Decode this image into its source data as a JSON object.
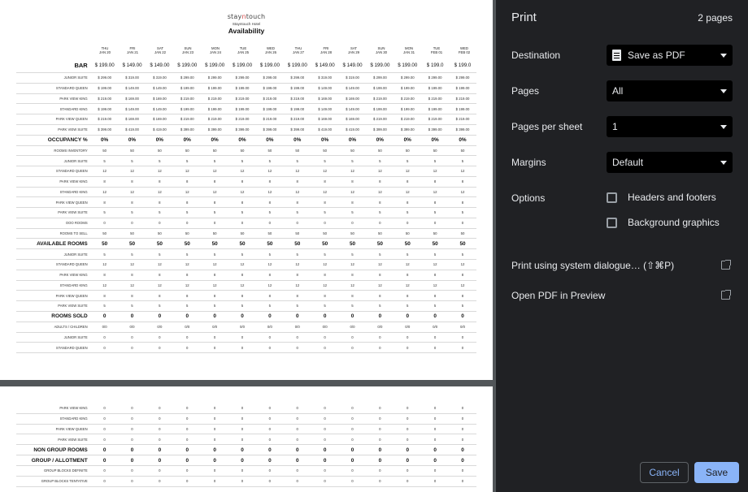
{
  "report": {
    "logo_prefix": "stay",
    "logo_accent": "n",
    "logo_suffix": "touch",
    "hotel": "Stayntouch Hotel",
    "title": "Availability",
    "dates": [
      {
        "d": "THU",
        "m": "JAN 20"
      },
      {
        "d": "FRI",
        "m": "JAN 21"
      },
      {
        "d": "SAT",
        "m": "JAN 22"
      },
      {
        "d": "SUN",
        "m": "JAN 23"
      },
      {
        "d": "MON",
        "m": "JAN 24"
      },
      {
        "d": "TUE",
        "m": "JAN 25"
      },
      {
        "d": "WED",
        "m": "JAN 26"
      },
      {
        "d": "THU",
        "m": "JAN 27"
      },
      {
        "d": "FRI",
        "m": "JAN 28"
      },
      {
        "d": "SAT",
        "m": "JAN 29"
      },
      {
        "d": "SUN",
        "m": "JAN 30"
      },
      {
        "d": "MON",
        "m": "JAN 31"
      },
      {
        "d": "TUE",
        "m": "FEB 01"
      },
      {
        "d": "WED",
        "m": "FEB 02"
      }
    ],
    "page1_rows": [
      {
        "label": "BAR",
        "style": "bar",
        "values": [
          "$ 199.00",
          "$ 149.00",
          "$ 149.00",
          "$ 199.00",
          "$ 199.00",
          "$ 199.00",
          "$ 199.00",
          "$ 199.00",
          "$ 149.00",
          "$ 149.00",
          "$ 199.00",
          "$ 199.00",
          "$ 199.0",
          "$ 199.0"
        ]
      },
      {
        "label": "JUNIOR SUITE",
        "values": [
          "$ 299.00",
          "$ 319.00",
          "$ 319.00",
          "$ 299.00",
          "$ 299.00",
          "$ 299.00",
          "$ 299.00",
          "$ 299.00",
          "$ 319.00",
          "$ 319.00",
          "$ 299.00",
          "$ 299.00",
          "$ 299.00",
          "$ 299.00"
        ]
      },
      {
        "label": "STANDARD QUEEN",
        "values": [
          "$ 199.00",
          "$ 149.00",
          "$ 149.00",
          "$ 199.00",
          "$ 199.00",
          "$ 199.00",
          "$ 199.00",
          "$ 199.00",
          "$ 149.00",
          "$ 149.00",
          "$ 199.00",
          "$ 199.00",
          "$ 199.00",
          "$ 199.00"
        ]
      },
      {
        "label": "PARK VIEW KING",
        "values": [
          "$ 219.00",
          "$ 169.00",
          "$ 169.00",
          "$ 219.00",
          "$ 219.00",
          "$ 219.00",
          "$ 219.00",
          "$ 219.00",
          "$ 169.00",
          "$ 169.00",
          "$ 219.00",
          "$ 219.00",
          "$ 219.00",
          "$ 219.00"
        ]
      },
      {
        "label": "STANDARD KING",
        "values": [
          "$ 199.00",
          "$ 149.00",
          "$ 149.00",
          "$ 199.00",
          "$ 199.00",
          "$ 199.00",
          "$ 199.00",
          "$ 199.00",
          "$ 149.00",
          "$ 149.00",
          "$ 199.00",
          "$ 199.00",
          "$ 199.00",
          "$ 199.00"
        ]
      },
      {
        "label": "PARK VIEW QUEEN",
        "values": [
          "$ 219.00",
          "$ 169.00",
          "$ 169.00",
          "$ 219.00",
          "$ 219.00",
          "$ 219.00",
          "$ 219.00",
          "$ 219.00",
          "$ 169.00",
          "$ 169.00",
          "$ 219.00",
          "$ 219.00",
          "$ 219.00",
          "$ 219.00"
        ]
      },
      {
        "label": "PARK VIEW SUITE",
        "values": [
          "$ 399.00",
          "$ 419.00",
          "$ 419.00",
          "$ 399.00",
          "$ 399.00",
          "$ 399.00",
          "$ 399.00",
          "$ 399.00",
          "$ 419.00",
          "$ 419.00",
          "$ 399.00",
          "$ 399.00",
          "$ 399.00",
          "$ 399.00"
        ]
      },
      {
        "label": "OCCUPANCY %",
        "style": "bold",
        "values": [
          "0%",
          "0%",
          "0%",
          "0%",
          "0%",
          "0%",
          "0%",
          "0%",
          "0%",
          "0%",
          "0%",
          "0%",
          "0%",
          "0%"
        ]
      },
      {
        "label": "ROOMS INVENTORY",
        "values": [
          "50",
          "50",
          "50",
          "50",
          "50",
          "50",
          "50",
          "50",
          "50",
          "50",
          "50",
          "50",
          "50",
          "50"
        ]
      },
      {
        "label": "JUNIOR SUITE",
        "values": [
          "5",
          "5",
          "5",
          "5",
          "5",
          "5",
          "5",
          "5",
          "5",
          "5",
          "5",
          "5",
          "5",
          "5"
        ]
      },
      {
        "label": "STANDARD QUEEN",
        "values": [
          "12",
          "12",
          "12",
          "12",
          "12",
          "12",
          "12",
          "12",
          "12",
          "12",
          "12",
          "12",
          "12",
          "12"
        ]
      },
      {
        "label": "PARK VIEW KING",
        "values": [
          "8",
          "8",
          "8",
          "8",
          "8",
          "8",
          "8",
          "8",
          "8",
          "8",
          "8",
          "8",
          "8",
          "8"
        ]
      },
      {
        "label": "STANDARD KING",
        "values": [
          "12",
          "12",
          "12",
          "12",
          "12",
          "12",
          "12",
          "12",
          "12",
          "12",
          "12",
          "12",
          "12",
          "12"
        ]
      },
      {
        "label": "PARK VIEW QUEEN",
        "values": [
          "8",
          "8",
          "8",
          "8",
          "8",
          "8",
          "8",
          "8",
          "8",
          "8",
          "8",
          "8",
          "8",
          "8"
        ]
      },
      {
        "label": "PARK VIEW SUITE",
        "values": [
          "5",
          "5",
          "5",
          "5",
          "5",
          "5",
          "5",
          "5",
          "5",
          "5",
          "5",
          "5",
          "5",
          "5"
        ]
      },
      {
        "label": "OOO ROOMS",
        "values": [
          "0",
          "0",
          "0",
          "0",
          "0",
          "0",
          "0",
          "0",
          "0",
          "0",
          "0",
          "0",
          "0",
          "0"
        ]
      },
      {
        "label": "ROOMS TO SELL",
        "values": [
          "50",
          "50",
          "50",
          "50",
          "50",
          "50",
          "50",
          "50",
          "50",
          "50",
          "50",
          "50",
          "50",
          "50"
        ]
      },
      {
        "label": "AVAILABLE ROOMS",
        "style": "bold",
        "values": [
          "50",
          "50",
          "50",
          "50",
          "50",
          "50",
          "50",
          "50",
          "50",
          "50",
          "50",
          "50",
          "50",
          "50"
        ]
      },
      {
        "label": "JUNIOR SUITE",
        "values": [
          "5",
          "5",
          "5",
          "5",
          "5",
          "5",
          "5",
          "5",
          "5",
          "5",
          "5",
          "5",
          "5",
          "5"
        ]
      },
      {
        "label": "STANDARD QUEEN",
        "values": [
          "12",
          "12",
          "12",
          "12",
          "12",
          "12",
          "12",
          "12",
          "12",
          "12",
          "12",
          "12",
          "12",
          "12"
        ]
      },
      {
        "label": "PARK VIEW KING",
        "values": [
          "8",
          "8",
          "8",
          "8",
          "8",
          "8",
          "8",
          "8",
          "8",
          "8",
          "8",
          "8",
          "8",
          "8"
        ]
      },
      {
        "label": "STANDARD KING",
        "values": [
          "12",
          "12",
          "12",
          "12",
          "12",
          "12",
          "12",
          "12",
          "12",
          "12",
          "12",
          "12",
          "12",
          "12"
        ]
      },
      {
        "label": "PARK VIEW QUEEN",
        "values": [
          "8",
          "8",
          "8",
          "8",
          "8",
          "8",
          "8",
          "8",
          "8",
          "8",
          "8",
          "8",
          "8",
          "8"
        ]
      },
      {
        "label": "PARK VIEW SUITE",
        "values": [
          "5",
          "5",
          "5",
          "5",
          "5",
          "5",
          "5",
          "5",
          "5",
          "5",
          "5",
          "5",
          "5",
          "5"
        ]
      },
      {
        "label": "ROOMS SOLD",
        "style": "bold",
        "values": [
          "0",
          "0",
          "0",
          "0",
          "0",
          "0",
          "0",
          "0",
          "0",
          "0",
          "0",
          "0",
          "0",
          "0"
        ]
      },
      {
        "label": "ADULTS / CHILDREN",
        "values": [
          "0/0",
          "0/0",
          "0/0",
          "0/0",
          "0/0",
          "0/0",
          "0/0",
          "0/0",
          "0/0",
          "0/0",
          "0/0",
          "0/0",
          "0/0",
          "0/0"
        ]
      },
      {
        "label": "JUNIOR SUITE",
        "values": [
          "0",
          "0",
          "0",
          "0",
          "0",
          "0",
          "0",
          "0",
          "0",
          "0",
          "0",
          "0",
          "0",
          "0"
        ]
      },
      {
        "label": "STANDARD QUEEN",
        "values": [
          "0",
          "0",
          "0",
          "0",
          "0",
          "0",
          "0",
          "0",
          "0",
          "0",
          "0",
          "0",
          "0",
          "0"
        ]
      }
    ],
    "page2_rows": [
      {
        "label": "PARK VIEW KING",
        "values": [
          "0",
          "0",
          "0",
          "0",
          "0",
          "0",
          "0",
          "0",
          "0",
          "0",
          "0",
          "0",
          "0",
          "0"
        ]
      },
      {
        "label": "STANDARD KING",
        "values": [
          "0",
          "0",
          "0",
          "0",
          "0",
          "0",
          "0",
          "0",
          "0",
          "0",
          "0",
          "0",
          "0",
          "0"
        ]
      },
      {
        "label": "PARK VIEW QUEEN",
        "values": [
          "0",
          "0",
          "0",
          "0",
          "0",
          "0",
          "0",
          "0",
          "0",
          "0",
          "0",
          "0",
          "0",
          "0"
        ]
      },
      {
        "label": "PARK VIEW SUITE",
        "values": [
          "0",
          "0",
          "0",
          "0",
          "0",
          "0",
          "0",
          "0",
          "0",
          "0",
          "0",
          "0",
          "0",
          "0"
        ]
      },
      {
        "label": "NON GROUP ROOMS",
        "style": "bold",
        "values": [
          "0",
          "0",
          "0",
          "0",
          "0",
          "0",
          "0",
          "0",
          "0",
          "0",
          "0",
          "0",
          "0",
          "0"
        ]
      },
      {
        "label": "GROUP / ALLOTMENT",
        "style": "bold",
        "values": [
          "0",
          "0",
          "0",
          "0",
          "0",
          "0",
          "0",
          "0",
          "0",
          "0",
          "0",
          "0",
          "0",
          "0"
        ]
      },
      {
        "label": "GROUP BLOCKS DEFINITE",
        "values": [
          "0",
          "0",
          "0",
          "0",
          "0",
          "0",
          "0",
          "0",
          "0",
          "0",
          "0",
          "0",
          "0",
          "0"
        ]
      },
      {
        "label": "GROUP BLOCKS TENTATIVE",
        "values": [
          "0",
          "0",
          "0",
          "0",
          "0",
          "0",
          "0",
          "0",
          "0",
          "0",
          "0",
          "0",
          "0",
          "0"
        ]
      }
    ]
  },
  "print_panel": {
    "title": "Print",
    "page_count": "2 pages",
    "destination_label": "Destination",
    "destination_value": "Save as PDF",
    "destination_icon": "document-icon",
    "pages_label": "Pages",
    "pages_value": "All",
    "pages_per_sheet_label": "Pages per sheet",
    "pages_per_sheet_value": "1",
    "margins_label": "Margins",
    "margins_value": "Default",
    "options_label": "Options",
    "option_headers": "Headers and footers",
    "option_headers_checked": false,
    "option_background": "Background graphics",
    "option_background_checked": false,
    "system_dialog": "Print using system dialogue… (⇧⌘P)",
    "open_preview": "Open PDF in Preview",
    "cancel": "Cancel",
    "save": "Save",
    "accent_color": "#8ab4f8",
    "background_color": "#202124"
  }
}
